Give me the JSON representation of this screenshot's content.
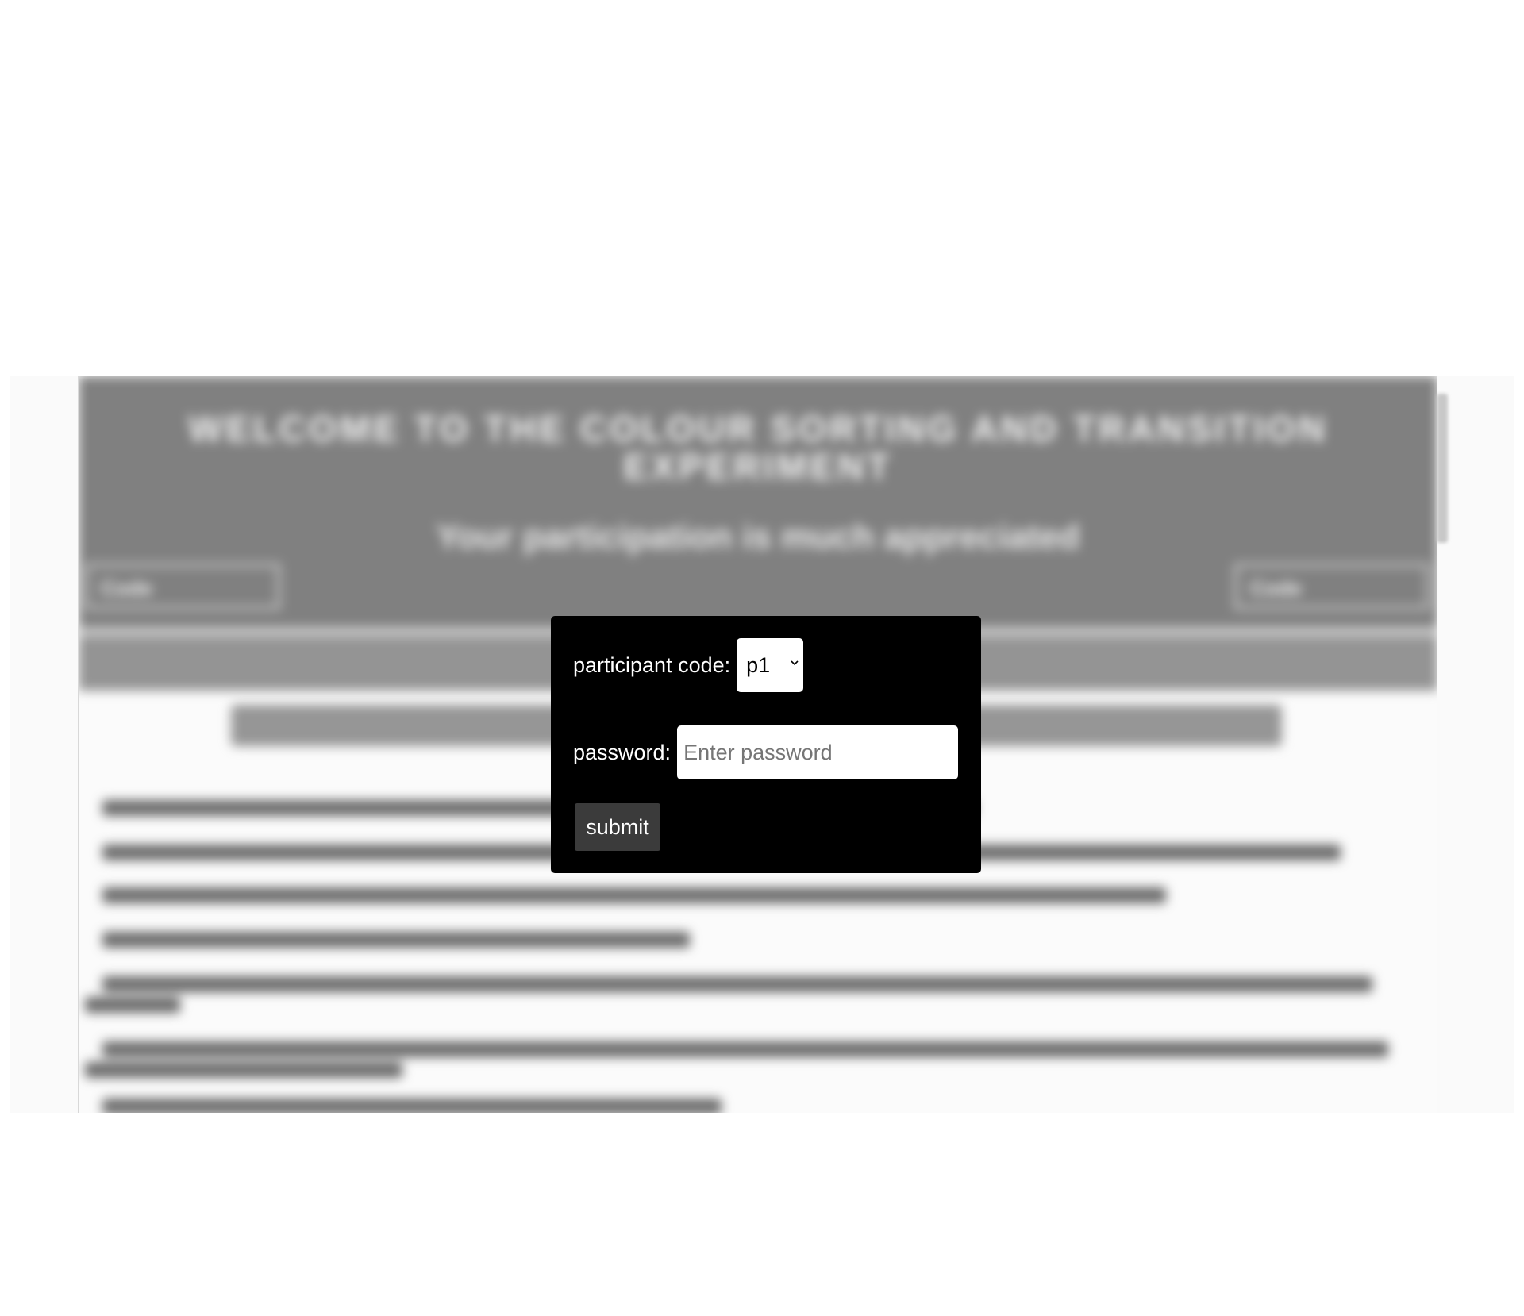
{
  "background_page": {
    "title": "WELCOME TO THE COLOUR SORTING AND TRANSITION EXPERIMENT",
    "subtitle": "Your participation is much appreciated",
    "code_left_label": "Code",
    "code_right_label": "Code"
  },
  "login": {
    "participant_label": "participant code:",
    "participant_selected": "p1",
    "password_label": "password:",
    "password_value": "",
    "password_placeholder": "Enter password",
    "submit_label": "submit"
  }
}
